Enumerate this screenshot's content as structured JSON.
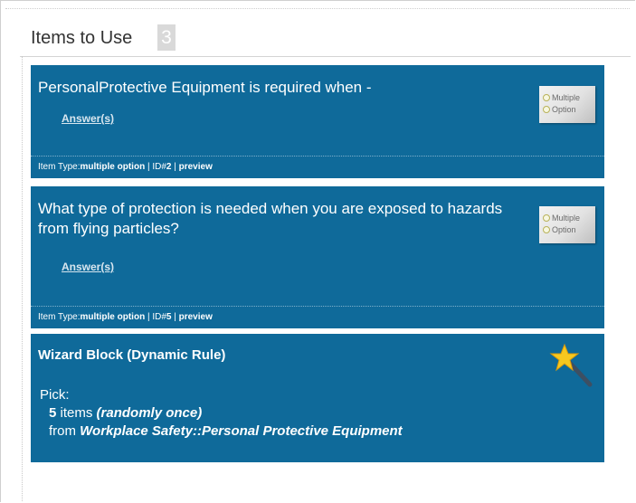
{
  "header": {
    "title": "Items to Use",
    "count": "3"
  },
  "items": [
    {
      "question": "PersonalProtective Equipment is required when -",
      "answers_label": "Answer(s)",
      "type_icon": {
        "name": "multiple-option-icon",
        "line1": "Multiple",
        "line2": "Option"
      },
      "footer": {
        "type_label": "Item Type:",
        "type_value": "multiple option",
        "id_label": " | ID#",
        "id_value": "2",
        "sep": " | ",
        "preview": "preview"
      }
    },
    {
      "question": "What type of protection is needed when you are exposed to hazards from flying particles?",
      "answers_label": "Answer(s)",
      "type_icon": {
        "name": "multiple-option-icon",
        "line1": "Multiple",
        "line2": "Option"
      },
      "footer": {
        "type_label": "Item Type:",
        "type_value": "multiple option",
        "id_label": " | ID#",
        "id_value": "5",
        "sep": " | ",
        "preview": "preview"
      }
    }
  ],
  "wizard": {
    "title": "Wizard Block (Dynamic Rule)",
    "pick_label": "Pick:",
    "count": "5",
    "items_word": " items ",
    "mode": "(randomly once)",
    "from_label": "from ",
    "source": "Workplace Safety::Personal Protective Equipment",
    "icon": "magic-wand-icon"
  },
  "colors": {
    "item_bg": "#0f6a9a",
    "badge_bg": "#d9d9d9",
    "wand_star": "#f6c81f"
  }
}
